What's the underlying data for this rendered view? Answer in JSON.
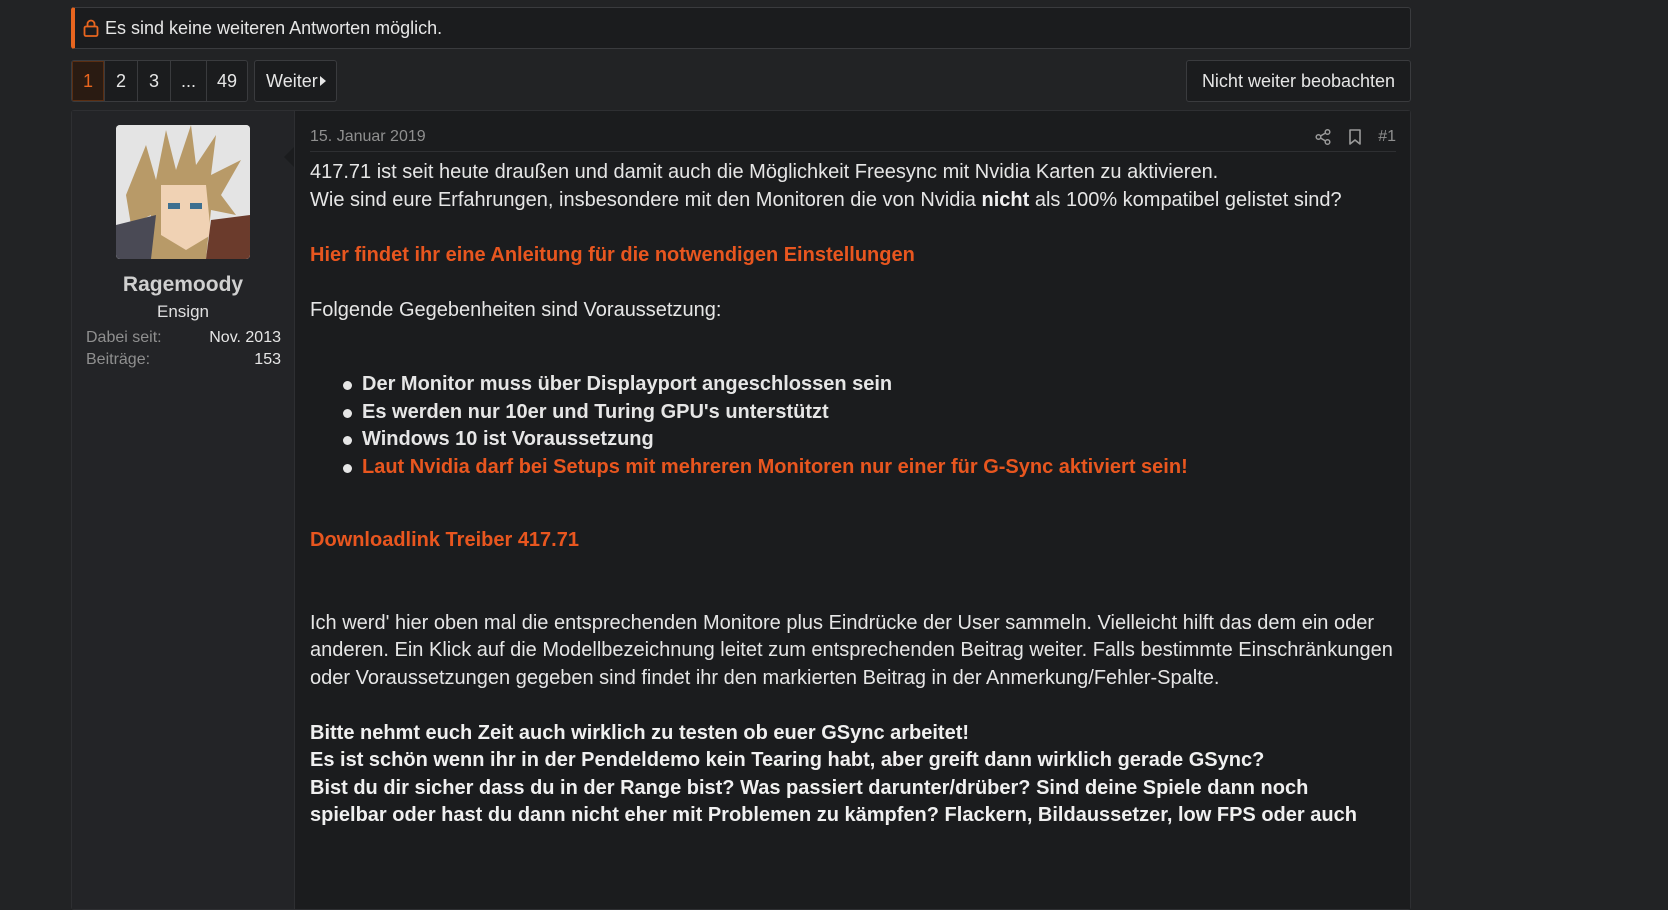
{
  "notice": {
    "text": "Es sind keine weiteren Antworten möglich."
  },
  "pagination": {
    "pages": [
      "1",
      "2",
      "3",
      "...",
      "49"
    ],
    "current": "1",
    "next_label": "Weiter"
  },
  "watch_button": {
    "label": "Nicht weiter beobachten"
  },
  "colors": {
    "accent": "#e8561f",
    "background": "#222325"
  },
  "post": {
    "user": {
      "name": "Ragemoody",
      "title": "Ensign",
      "joined_label": "Dabei seit:",
      "joined_value": "Nov. 2013",
      "posts_label": "Beiträge:",
      "posts_value": "153"
    },
    "date": "15. Januar 2019",
    "number": "#1",
    "icons": [
      "share-icon",
      "bookmark-icon"
    ],
    "intro_line1": "417.71 ist seit heute draußen und damit auch die Möglichkeit Freesync mit Nvidia Karten zu aktivieren.",
    "intro_line2_a": "Wie sind eure Erfahrungen, insbesondere mit den Monitoren die von Nvidia ",
    "intro_line2_bold": "nicht",
    "intro_line2_b": " als 100% kompatibel gelistet sind?",
    "guide_link": "Hier findet ihr eine Anleitung für die notwendigen Einstellungen",
    "requirements_intro": "Folgende Gegebenheiten sind Voraussetzung:",
    "requirements": [
      "Der Monitor muss über Displayport angeschlossen sein",
      "Es werden nur 10er und Turing GPU's unterstützt",
      "Windows 10 ist Voraussetzung",
      "Laut Nvidia darf bei Setups mit mehreren Monitoren nur einer für G-Sync aktiviert sein!"
    ],
    "download_link": "Downloadlink Treiber 417.71",
    "paragraph": "Ich werd' hier oben mal die entsprechenden Monitore plus Eindrücke der User sammeln. Vielleicht hilft das dem ein oder anderen. Ein Klick auf die Modellbezeichnung leitet zum entsprechenden Beitrag weiter. Falls bestimmte Einschränkungen oder Voraussetzungen gegeben sind findet ihr den markierten Beitrag in der Anmerkung/Fehler-Spalte.",
    "bold_line1": "Bitte nehmt euch Zeit auch wirklich zu testen ob euer GSync arbeitet!",
    "bold_line2": "Es ist schön wenn ihr in der Pendeldemo kein Tearing habt, aber greift dann wirklich gerade GSync?",
    "bold_line3": "Bist du dir sicher dass du in der Range bist? Was passiert darunter/drüber? Sind deine Spiele dann noch",
    "bold_line4": "spielbar oder hast du dann nicht eher mit Problemen zu kämpfen? Flackern, Bildaussetzer, low FPS oder auch"
  }
}
